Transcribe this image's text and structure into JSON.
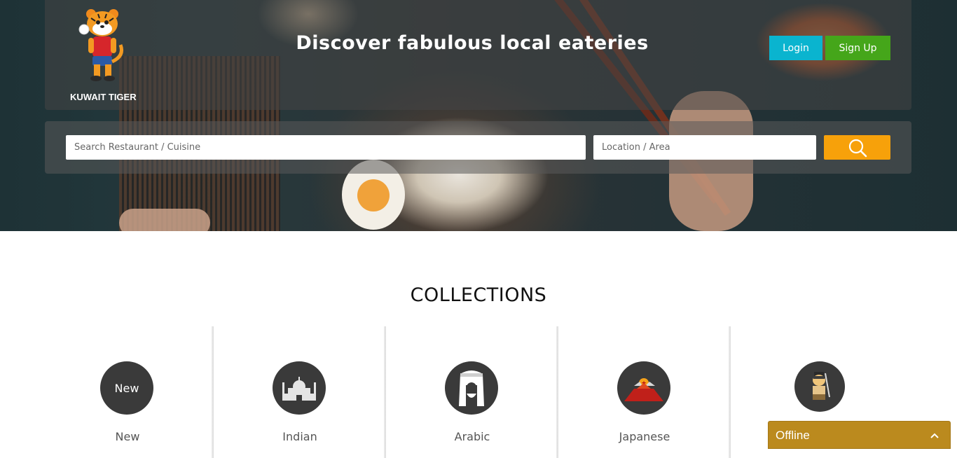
{
  "brand": {
    "name": "KUWAIT TIGER"
  },
  "header": {
    "headline": "Discover fabulous local eateries",
    "login_label": "Login",
    "signup_label": "Sign Up"
  },
  "search": {
    "restaurant_placeholder": "Search Restaurant / Cuisine",
    "location_placeholder": "Location / Area",
    "button_icon": "search-icon"
  },
  "collections": {
    "title": "COLLECTIONS",
    "items": [
      {
        "label": "New",
        "badge_text": "New",
        "icon": "new-icon"
      },
      {
        "label": "Indian",
        "icon": "taj-mahal-icon"
      },
      {
        "label": "Arabic",
        "icon": "arab-man-icon"
      },
      {
        "label": "Japanese",
        "icon": "mount-fuji-icon"
      },
      {
        "label": "",
        "icon": "samurai-icon"
      }
    ]
  },
  "chat": {
    "status_label": "Offline",
    "toggle_icon": "chevron-up-icon"
  },
  "colors": {
    "login": "#0ab4cf",
    "signup": "#45a61a",
    "search_button": "#f7a10a",
    "offline": "#bb8a1e",
    "icon_circle": "#3a3a3a"
  }
}
